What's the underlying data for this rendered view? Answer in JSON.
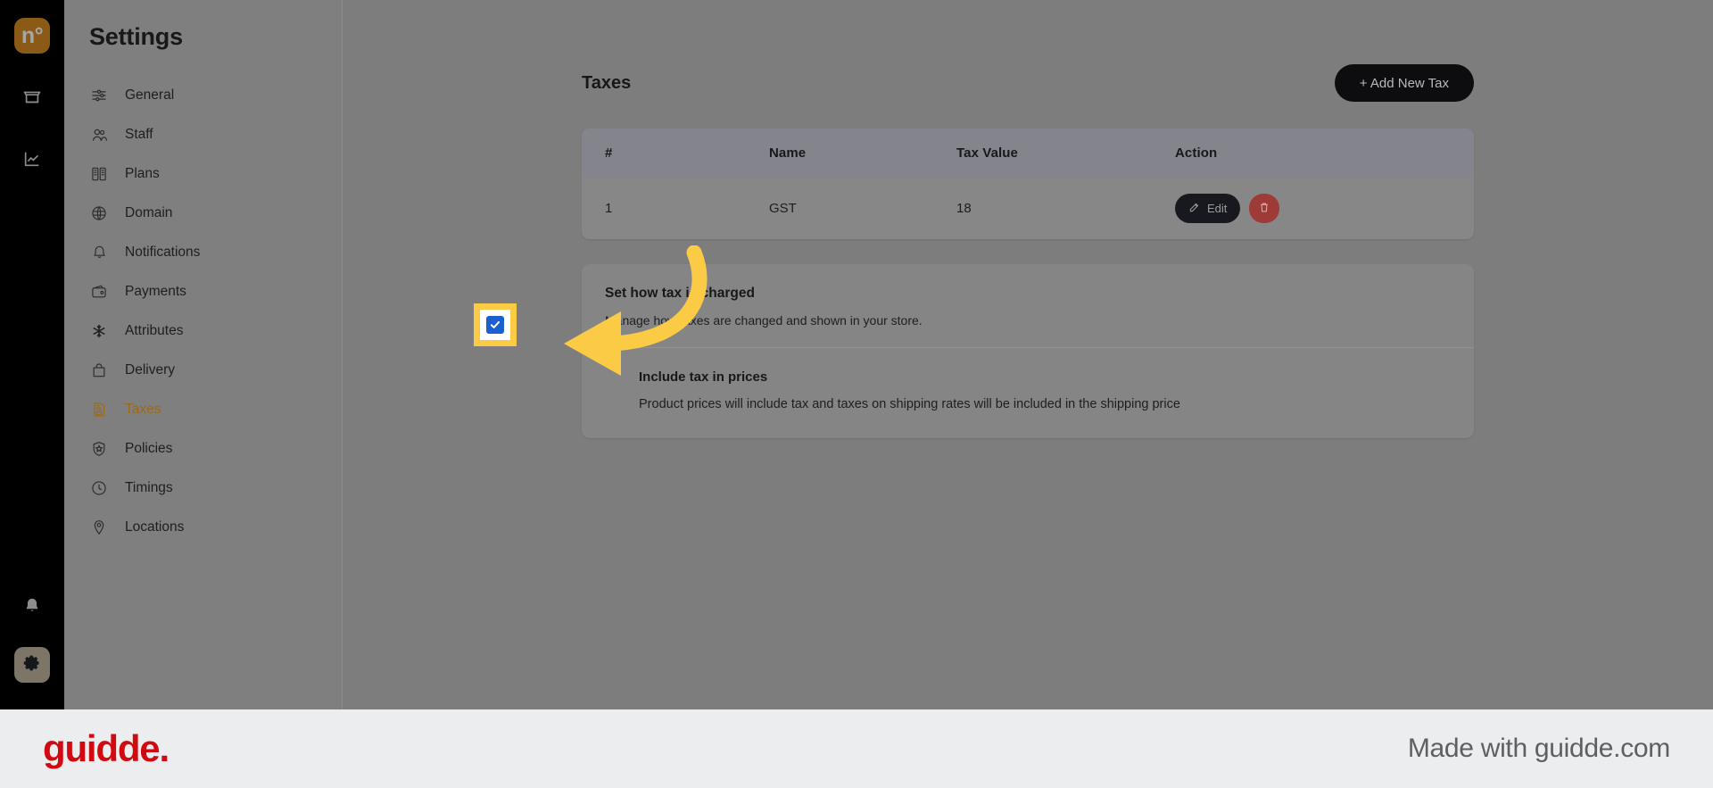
{
  "rail": {
    "logo_text": "n°",
    "items": [
      {
        "name": "store-icon",
        "label": "Store"
      },
      {
        "name": "analytics-icon",
        "label": "Analytics"
      }
    ],
    "bottom": [
      {
        "name": "bell-icon",
        "label": "Notifications"
      },
      {
        "name": "gear-icon",
        "label": "Settings"
      }
    ]
  },
  "sidebar": {
    "title": "Settings",
    "items": [
      {
        "label": "General",
        "icon": "sliders-icon",
        "active": false
      },
      {
        "label": "Staff",
        "icon": "users-icon",
        "active": false
      },
      {
        "label": "Plans",
        "icon": "catalog-icon",
        "active": false
      },
      {
        "label": "Domain",
        "icon": "globe-icon",
        "active": false
      },
      {
        "label": "Notifications",
        "icon": "bell-icon",
        "active": false
      },
      {
        "label": "Payments",
        "icon": "wallet-icon",
        "active": false
      },
      {
        "label": "Attributes",
        "icon": "asterisk-icon",
        "active": false
      },
      {
        "label": "Delivery",
        "icon": "bag-icon",
        "active": false
      },
      {
        "label": "Taxes",
        "icon": "tax-document-icon",
        "active": true
      },
      {
        "label": "Policies",
        "icon": "shield-star-icon",
        "active": false
      },
      {
        "label": "Timings",
        "icon": "clock-icon",
        "active": false
      },
      {
        "label": "Locations",
        "icon": "map-pin-icon",
        "active": false
      }
    ]
  },
  "main": {
    "heading": "Taxes",
    "add_button_label": "+ Add New Tax",
    "table": {
      "columns": [
        "#",
        "Name",
        "Tax Value",
        "Action"
      ],
      "rows": [
        {
          "num": "1",
          "name": "GST",
          "value": "18",
          "edit_label": "Edit",
          "delete_label": "Delete"
        }
      ]
    },
    "tax_charge_section": {
      "title": "Set how tax is charged",
      "subtitle": "Manage how taxes are changed and shown in your store.",
      "option": {
        "label": "Include tax in prices",
        "description": "Product prices will include tax and taxes on shipping rates will be included in the shipping price",
        "checked": true
      }
    }
  },
  "footer": {
    "logo": "guidde.",
    "made_with": "Made with guidde.com"
  },
  "colors": {
    "brand_amber": "#8a5a16",
    "active_nav": "#9a6a1c",
    "highlight_yellow": "#fbcb46",
    "checkbox_blue": "#1a60d0",
    "delete_red": "#9e3a38",
    "guidde_red": "#d00a10"
  }
}
